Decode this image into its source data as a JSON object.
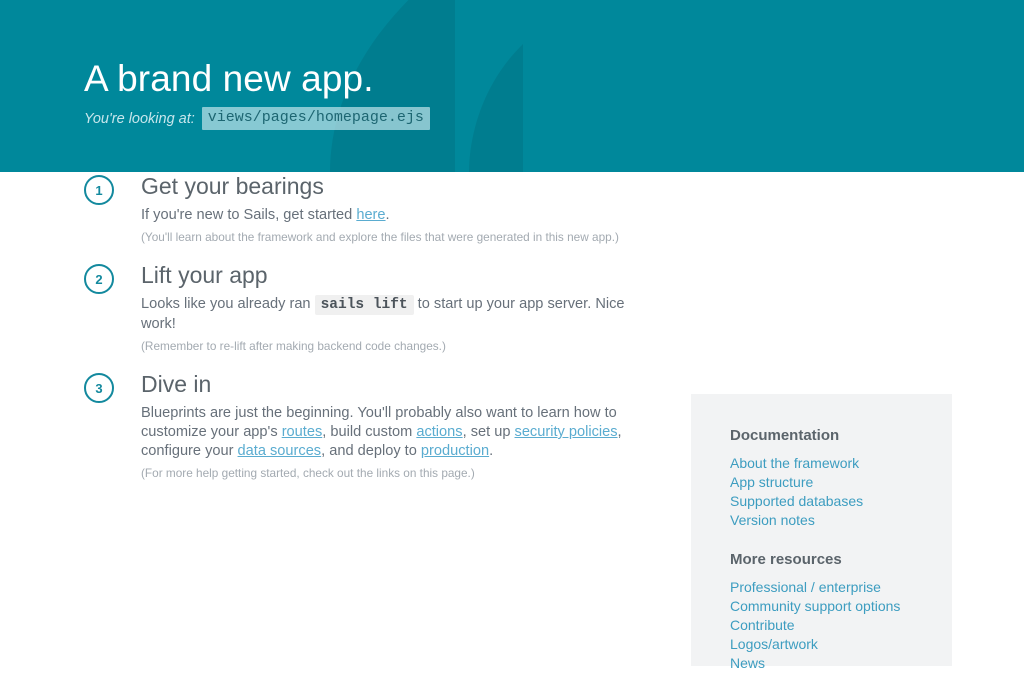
{
  "header": {
    "title": "A brand new app.",
    "looking_label": "You're looking at:",
    "file_path": "views/pages/homepage.ejs",
    "background_color": "#00889b",
    "art_color": "#007e90",
    "art_name": "sails-boat-watermark"
  },
  "steps": [
    {
      "number": "1",
      "title": "Get your bearings",
      "text_before": "If you're new to Sails, get started ",
      "link_text": "here",
      "text_after": ".",
      "note": "(You'll learn about the framework and explore the files that were generated in this new app.)"
    },
    {
      "number": "2",
      "title": "Lift your app",
      "text_before": "Looks like you already ran ",
      "code": "sails lift",
      "text_after": " to start up your app server. Nice work!",
      "note": "(Remember to re-lift after making backend code changes.)"
    },
    {
      "number": "3",
      "title": "Dive in",
      "segment_1": "Blueprints are just the beginning. You'll probably also want to learn how to customize your app's ",
      "link_1": "routes",
      "segment_2": ", build custom ",
      "link_2": "actions",
      "segment_3": ", set up ",
      "link_3": "security policies",
      "segment_4": ", configure your ",
      "link_4": "data sources",
      "segment_5": ", and deploy to ",
      "link_5": "production",
      "segment_6": ".",
      "note": "(For more help getting started, check out the links on this page.)"
    }
  ],
  "sidebar": {
    "background_color": "#f2f3f4",
    "link_color": "#3d9dc0",
    "sections": [
      {
        "heading": "Documentation",
        "links": [
          "About the framework",
          "App structure",
          "Supported databases",
          "Version notes"
        ]
      },
      {
        "heading": "More resources",
        "links": [
          "Professional / enterprise",
          "Community support options",
          "Contribute",
          "Logos/artwork",
          "News"
        ]
      }
    ]
  }
}
